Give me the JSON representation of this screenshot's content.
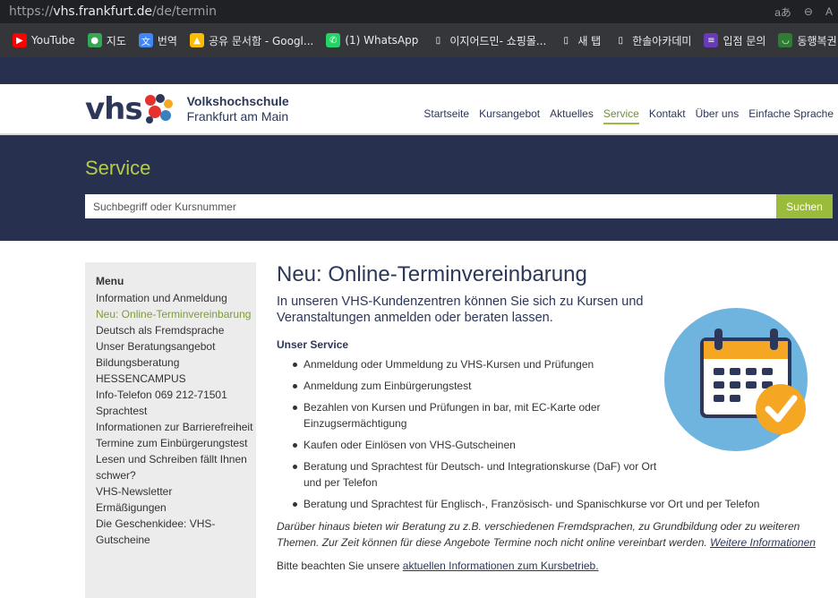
{
  "browser": {
    "url_prefix": "https://",
    "url_domain": "vhs.frankfurt.de",
    "url_path": "/de/termin",
    "bookmarks": [
      {
        "label": "YouTube",
        "icon": "youtube-icon",
        "color": "#ff0000"
      },
      {
        "label": "지도",
        "icon": "maps-icon",
        "color": "#34a853"
      },
      {
        "label": "번역",
        "icon": "translate-icon",
        "color": "#4285f4"
      },
      {
        "label": "공유 문서함 - Googl...",
        "icon": "drive-icon",
        "color": "#fbbc04"
      },
      {
        "label": "(1) WhatsApp",
        "icon": "whatsapp-icon",
        "color": "#25d366"
      },
      {
        "label": "이지어드민- 쇼핑몰...",
        "icon": "page-icon",
        "color": "#35363a"
      },
      {
        "label": "새 탭",
        "icon": "page-icon",
        "color": "#35363a"
      },
      {
        "label": "한솔아카데미",
        "icon": "page-icon",
        "color": "#35363a"
      },
      {
        "label": "입점 문의",
        "icon": "forms-icon",
        "color": "#673ab7"
      },
      {
        "label": "동행복권",
        "icon": "lotto-icon",
        "color": "#2e7d32"
      }
    ]
  },
  "site": {
    "logo_text": "vhs",
    "org_line1": "Volkshochschule",
    "org_line2": "Frankfurt am Main",
    "nav": [
      "Startseite",
      "Kursangebot",
      "Aktuelles",
      "Service",
      "Kontakt",
      "Über uns",
      "Einfache Sprache"
    ],
    "nav_active": "Service",
    "accent": "#9bbb3c",
    "navy": "#27304f"
  },
  "hero": {
    "title": "Service",
    "search_placeholder": "Suchbegriff oder Kursnummer",
    "search_button": "Suchen"
  },
  "sidebar": {
    "title": "Menu",
    "items": [
      "Information und Anmeldung",
      "Neu: Online-Terminvereinbarung",
      "Deutsch als Fremdsprache",
      "Unser Beratungsangebot",
      "Bildungsberatung",
      "HESSENCAMPUS",
      "Info-Telefon 069 212-71501",
      "Sprachtest",
      "Informationen zur Barrierefreiheit",
      "Termine zum Einbürgerungstest",
      "Lesen und Schreiben fällt Ihnen schwer?",
      "VHS-Newsletter",
      "Ermäßigungen",
      "Die Geschenkidee: VHS-Gutscheine"
    ],
    "active_index": 1
  },
  "main": {
    "title": "Neu: Online-Terminvereinbarung",
    "lead": "In unseren VHS-Kundenzentren können Sie sich zu Kursen und Veranstaltungen anmelden oder beraten lassen.",
    "subhead": "Unser Service",
    "bullets": [
      "Anmeldung oder Ummeldung zu VHS-Kursen und Prüfungen",
      "Anmeldung zum Einbürgerungstest",
      "Bezahlen von Kursen und Prüfungen in bar, mit EC-Karte oder Einzugsermächtigung",
      "Kaufen oder Einlösen von VHS-Gutscheinen",
      "Beratung und Sprachtest für Deutsch- und Integrationskurse (DaF) vor Ort und per Telefon",
      "Beratung und Sprachtest für Englisch-, Französisch- und Spanischkurse vor Ort und per Telefon"
    ],
    "note": "Darüber hinaus bieten wir Beratung zu z.B. verschiedenen Fremdsprachen, zu Grundbildung oder zu weiteren Themen. Zur Zeit können für diese Angebote Termine noch nicht online vereinbart werden.",
    "note_link": "Weitere Informationen",
    "info_text": "Bitte beachten Sie unsere",
    "info_link": "aktuellen Informationen zum Kursbetrieb."
  }
}
